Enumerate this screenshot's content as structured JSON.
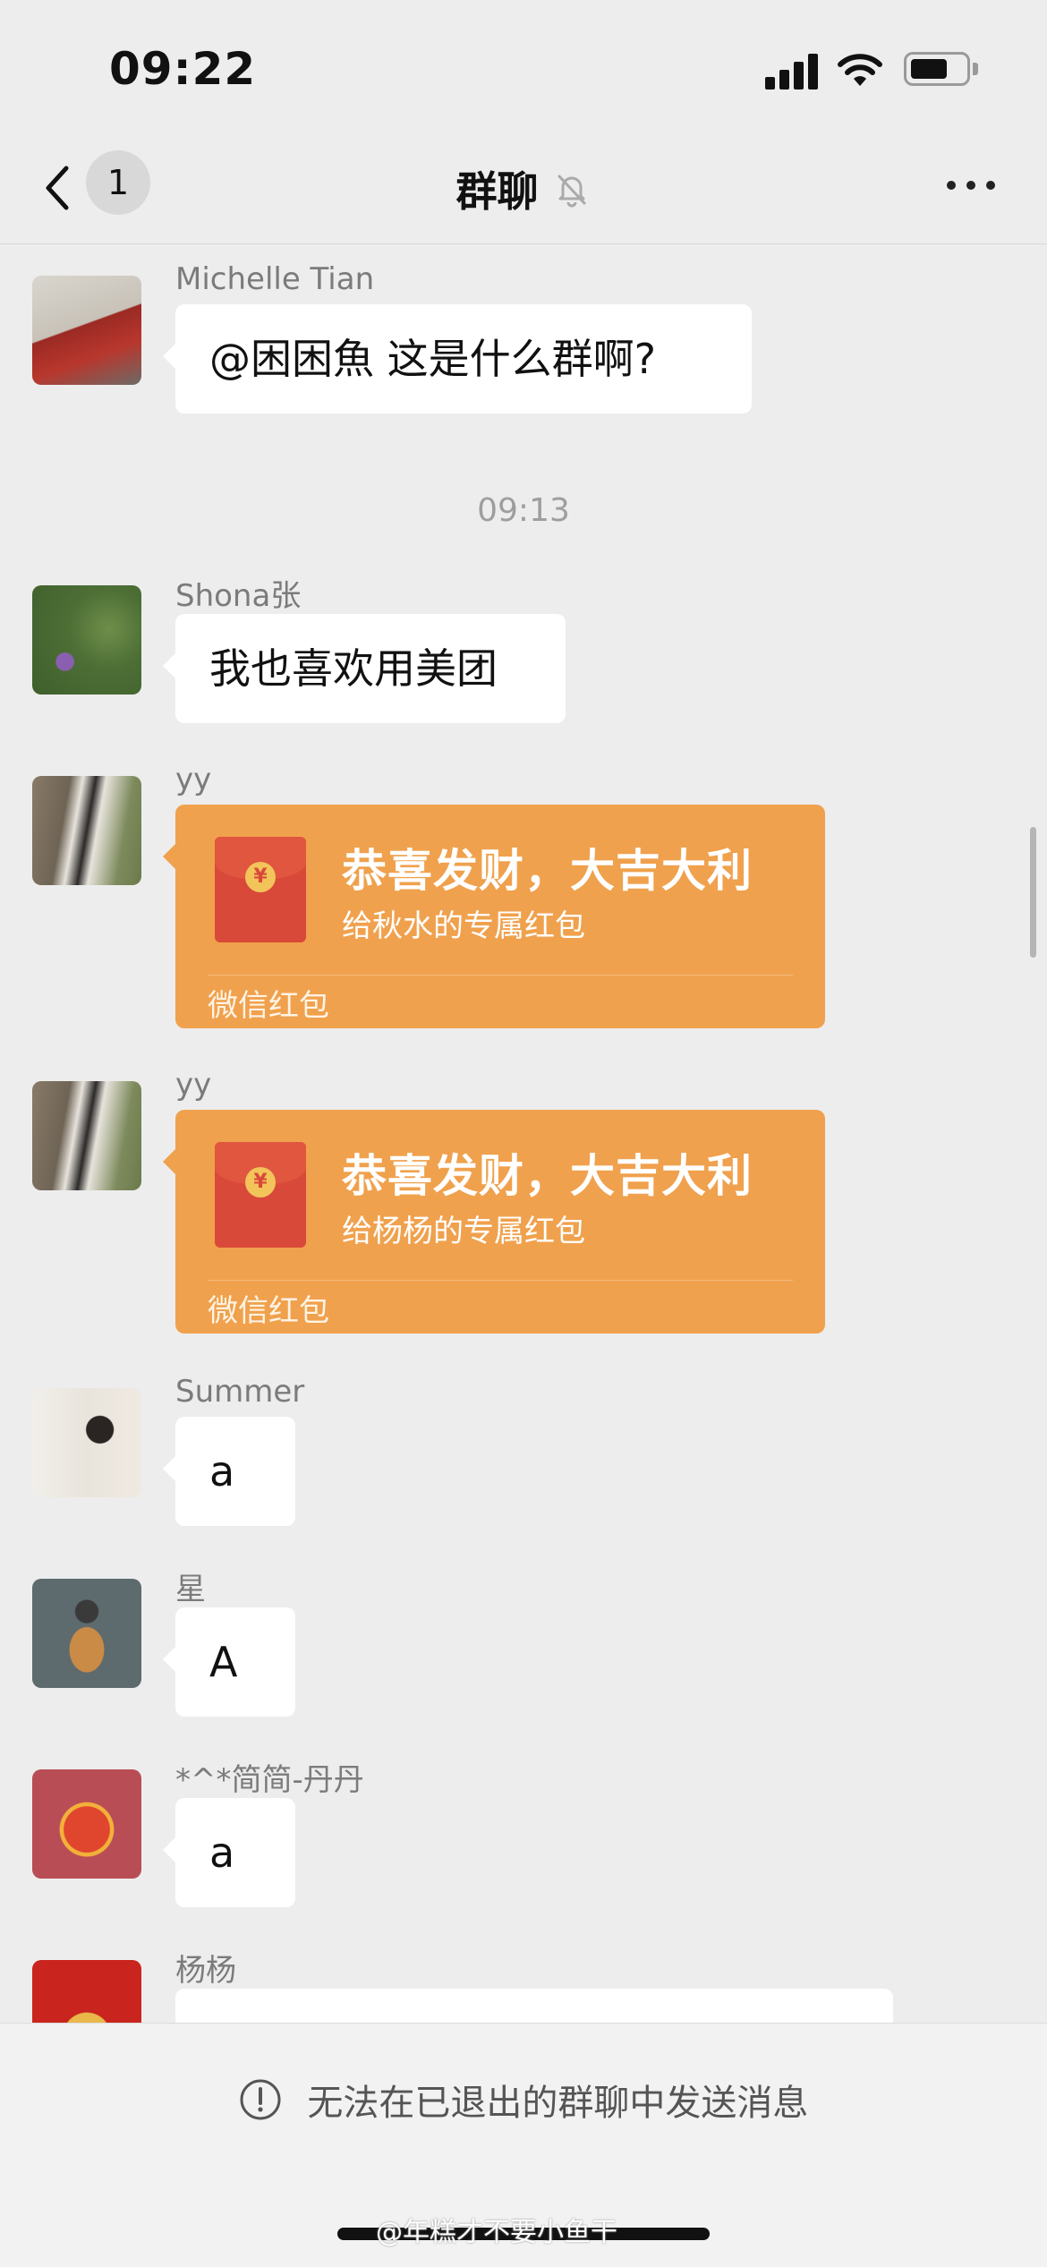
{
  "status_bar": {
    "time": "09:22"
  },
  "nav": {
    "unread_count": "1",
    "title": "群聊"
  },
  "messages": [
    {
      "sender": "Michelle Tian",
      "text": "@困困魚 这是什么群啊?"
    },
    {
      "timestamp": "09:13"
    },
    {
      "sender": "Shona张",
      "text": "我也喜欢用美团"
    },
    {
      "sender": "yy",
      "red_packet": {
        "title": "恭喜发财，大吉大利",
        "subtitle": "给秋水的专属红包",
        "footer": "微信红包"
      }
    },
    {
      "sender": "yy",
      "red_packet": {
        "title": "恭喜发财，大吉大利",
        "subtitle": "给杨杨的专属红包",
        "footer": "微信红包"
      }
    },
    {
      "sender": "Summer",
      "text": "a"
    },
    {
      "sender": "星",
      "text": "A"
    },
    {
      "sender": "*^*简简-丹丹",
      "text": "a"
    },
    {
      "sender": "杨杨",
      "text": ""
    }
  ],
  "bottom": {
    "notice": "无法在已退出的群聊中发送消息",
    "watermark": "@年糕才不要小鱼干"
  },
  "colors": {
    "background": "#ededed",
    "bubble": "#ffffff",
    "red_packet": "#f0a14d",
    "red_packet_icon": "#d9493a"
  },
  "icons": [
    "back-chevron-icon",
    "mute-bell-icon",
    "more-dots-icon",
    "exclamation-circle-icon",
    "yuan-coin-icon"
  ]
}
